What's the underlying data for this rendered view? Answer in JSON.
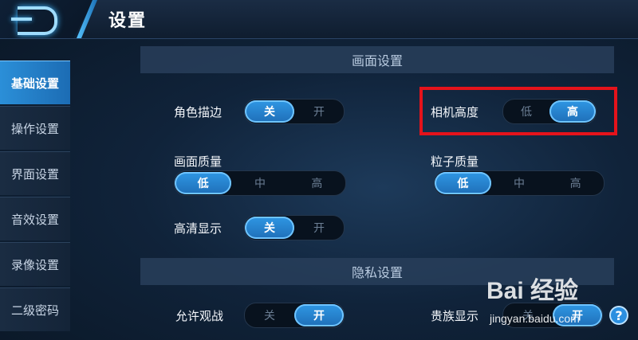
{
  "header": {
    "title": "设置"
  },
  "sidebar": {
    "items": [
      {
        "label": "基础设置",
        "active": true
      },
      {
        "label": "操作设置"
      },
      {
        "label": "界面设置"
      },
      {
        "label": "音效设置"
      },
      {
        "label": "录像设置"
      },
      {
        "label": "二级密码"
      }
    ]
  },
  "sections": {
    "graphics": {
      "title": "画面设置"
    },
    "privacy": {
      "title": "隐私设置"
    }
  },
  "settings": {
    "outline": {
      "label": "角色描边",
      "options": [
        "关",
        "开"
      ],
      "selected": "关"
    },
    "camera_height": {
      "label": "相机高度",
      "options": [
        "低",
        "高"
      ],
      "selected": "高"
    },
    "graphics_quality": {
      "label": "画面质量",
      "options": [
        "低",
        "中",
        "高"
      ],
      "selected": "低"
    },
    "particle_quality": {
      "label": "粒子质量",
      "options": [
        "低",
        "中",
        "高"
      ],
      "selected": "低"
    },
    "hd_display": {
      "label": "高清显示",
      "options": [
        "关",
        "开"
      ],
      "selected": "关"
    },
    "allow_spectate": {
      "label": "允许观战",
      "options": [
        "关",
        "开"
      ],
      "selected": "开"
    },
    "noble_display": {
      "label": "贵族显示",
      "options": [
        "关",
        "开"
      ],
      "selected": "开"
    }
  },
  "watermark": {
    "main": "Bai 经验",
    "sub": "jingyan.baidu.com"
  },
  "colors": {
    "accent": "#2b8fd8",
    "highlight": "#e5131b"
  }
}
